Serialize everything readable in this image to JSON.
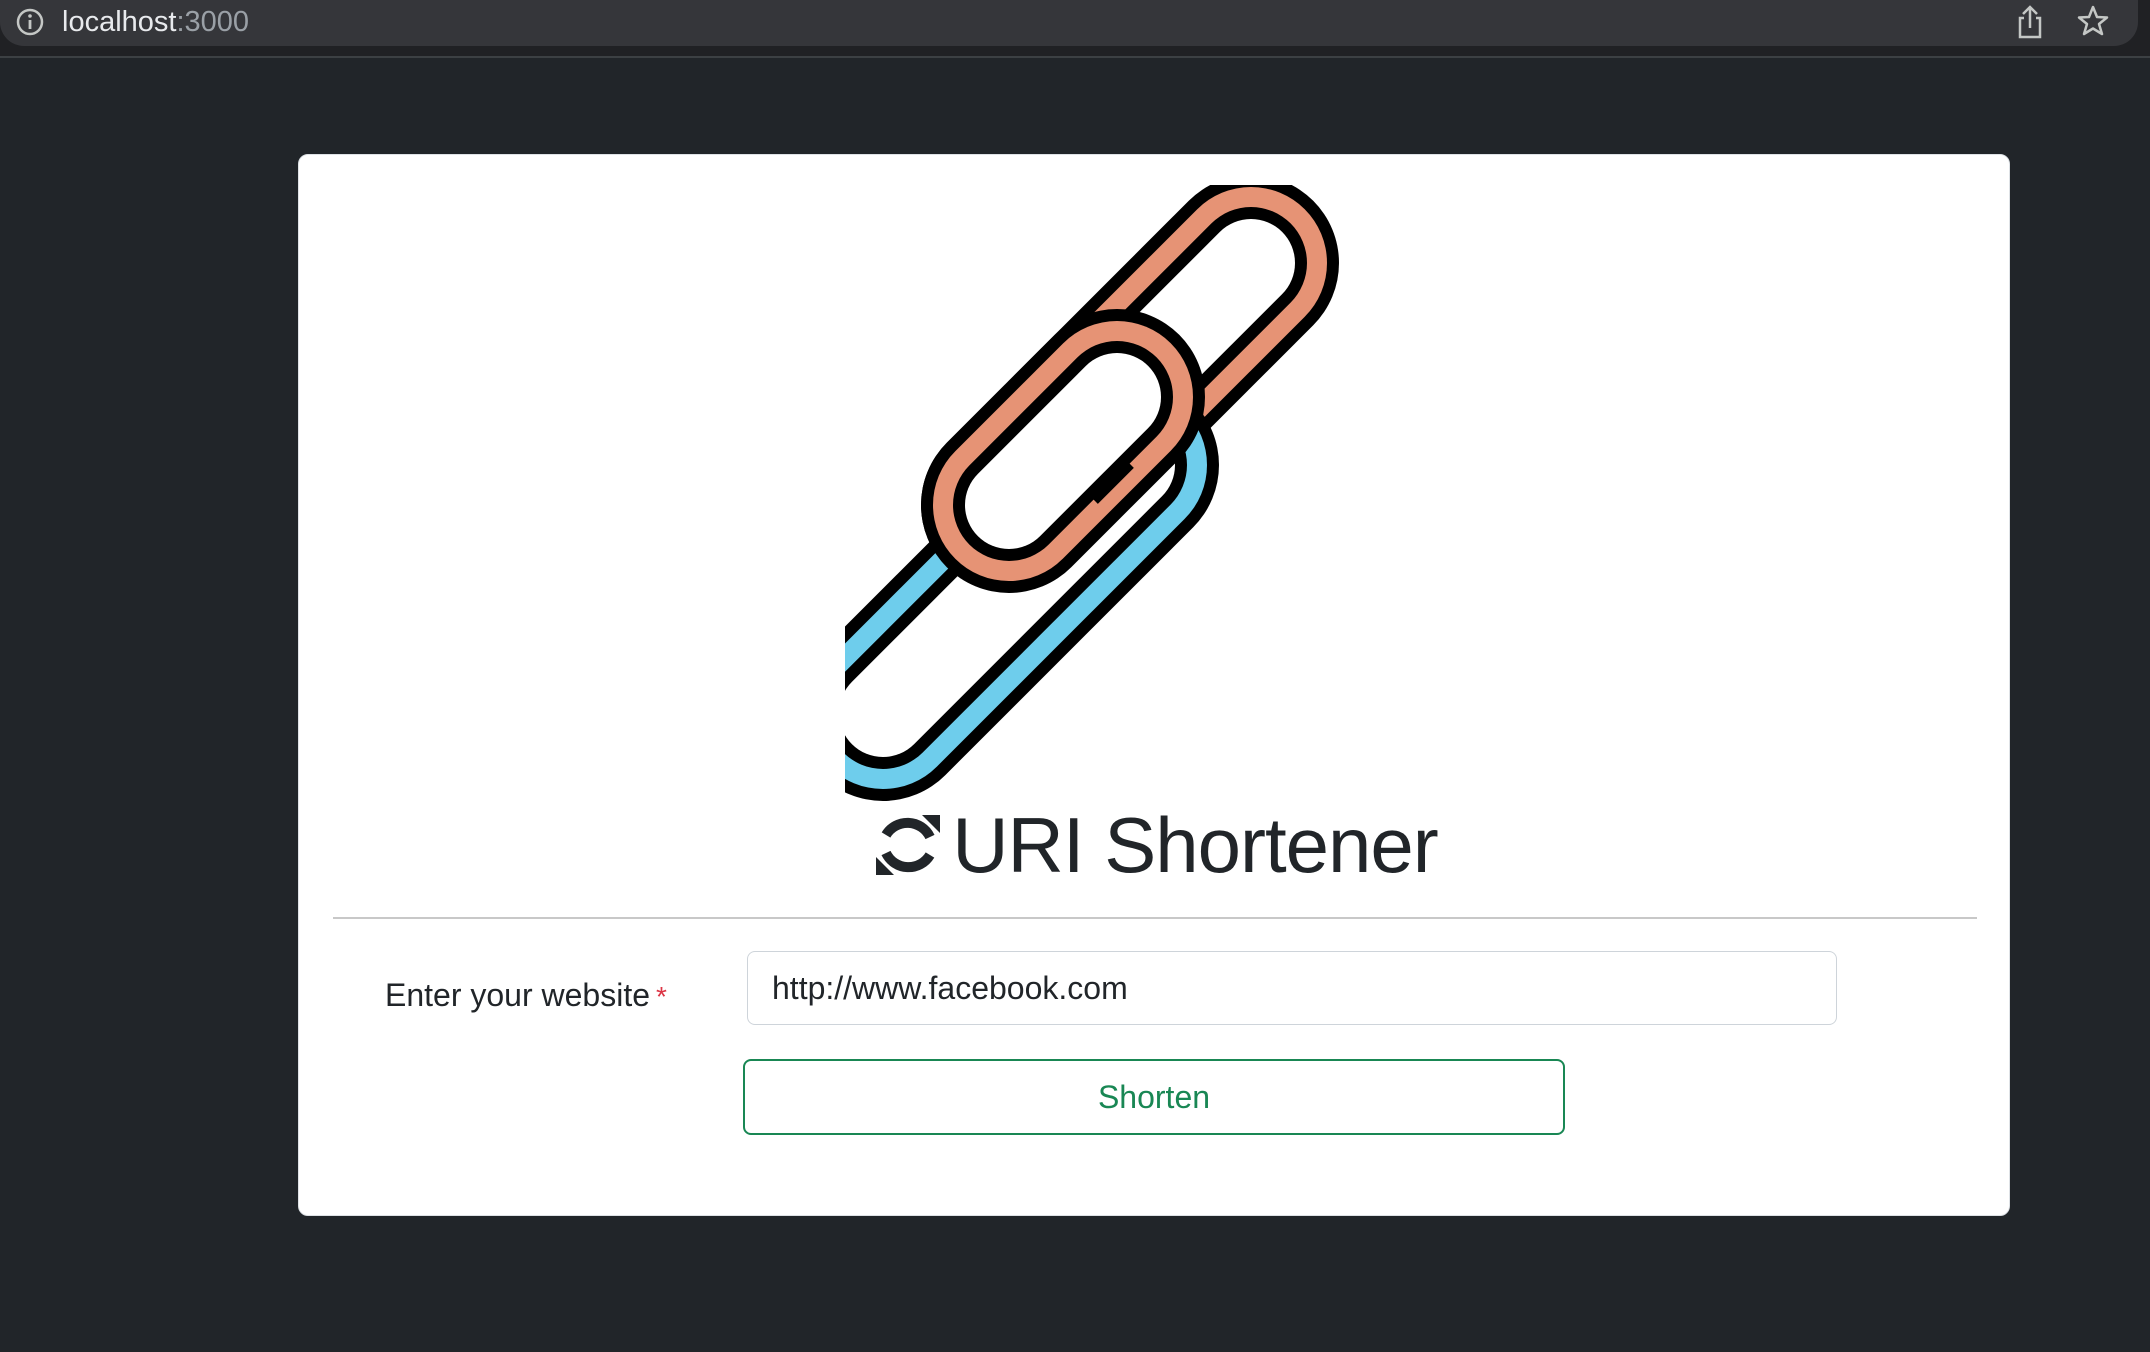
{
  "browser": {
    "host": "localhost",
    "port": ":3000"
  },
  "logo": {
    "icon": "chain-link-icon",
    "colors": {
      "link_top": "#e69375",
      "link_bottom": "#6ecdec",
      "outline": "#000000"
    }
  },
  "header": {
    "title_icon": "sync-icon",
    "title": "URI Shortener"
  },
  "form": {
    "label": "Enter your website",
    "required_marker": "*",
    "input_value": "http://www.facebook.com",
    "submit_label": "Shorten"
  },
  "colors": {
    "background": "#212529",
    "card": "#ffffff",
    "accent_green": "#198754",
    "required_red": "#dc3545"
  }
}
